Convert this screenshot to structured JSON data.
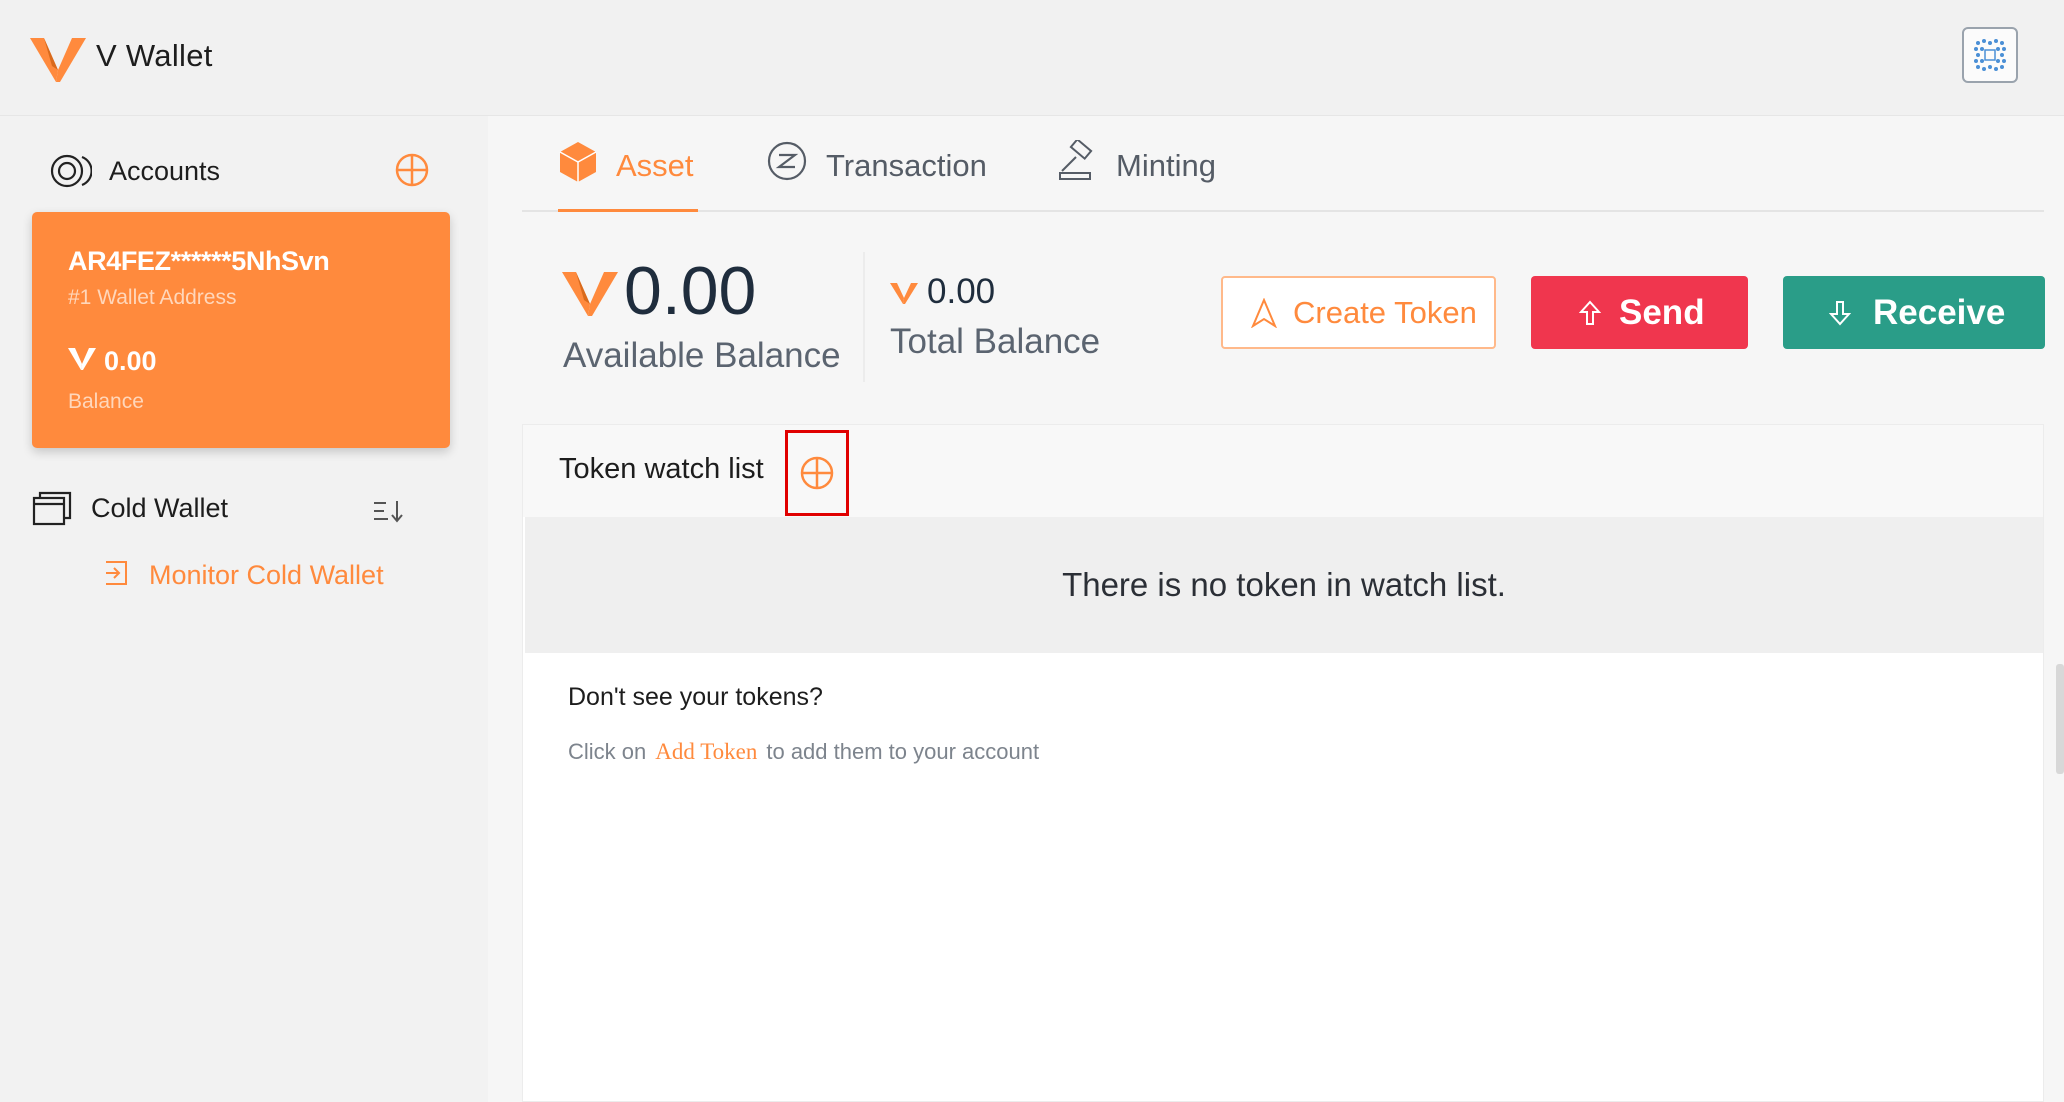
{
  "app": {
    "title": "V Wallet",
    "accent": "#ff8a3d"
  },
  "header": {
    "qr_icon": "qr-scan-icon"
  },
  "sidebar": {
    "accounts_title": "Accounts",
    "account": {
      "address": "AR4FEZ******5NhSvn",
      "index_label": "#1 Wallet Address",
      "balance": "0.00",
      "balance_label": "Balance"
    },
    "cold_wallet_title": "Cold Wallet",
    "monitor_link": "Monitor Cold Wallet"
  },
  "tabs": [
    {
      "label": "Asset",
      "active": true
    },
    {
      "label": "Transaction",
      "active": false
    },
    {
      "label": "Minting",
      "active": false
    }
  ],
  "balances": {
    "available_amount": "0.00",
    "available_label": "Available Balance",
    "total_amount": "0.00",
    "total_label": "Total Balance"
  },
  "actions": {
    "create_token": "Create Token",
    "send": "Send",
    "receive": "Receive",
    "send_color": "#f0364e",
    "receive_color": "#2a9d88"
  },
  "watch_list": {
    "title": "Token watch list",
    "empty_message": "There is no token in watch list.",
    "dont_see": "Don't see your tokens?",
    "hint_prefix": "Click on",
    "hint_link": "Add Token",
    "hint_suffix": "to add them to your account"
  }
}
